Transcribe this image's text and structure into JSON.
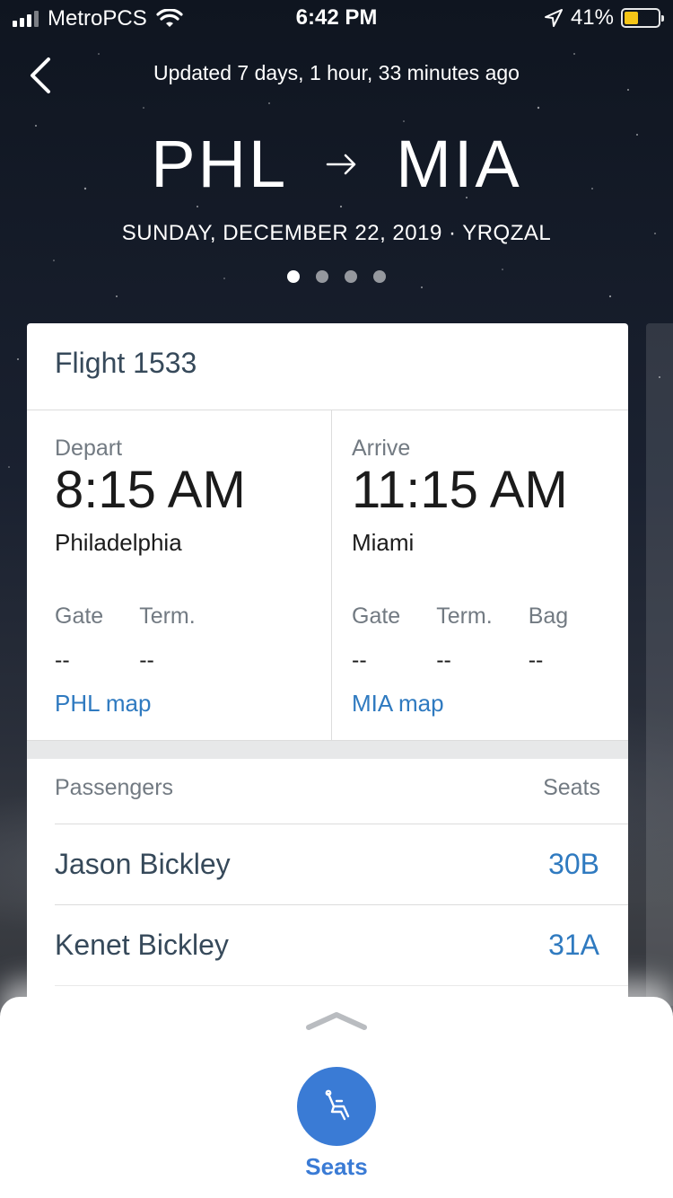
{
  "status_bar": {
    "carrier": "MetroPCS",
    "time": "6:42 PM",
    "battery": "41%"
  },
  "header": {
    "updated": "Updated 7 days, 1 hour, 33 minutes ago",
    "origin": "PHL",
    "destination": "MIA",
    "date_line": "SUNDAY, DECEMBER 22, 2019 · YRQZAL",
    "pages": 4,
    "active_page": 1
  },
  "card": {
    "flight": "Flight 1533",
    "depart": {
      "label": "Depart",
      "time": "8:15 AM",
      "city": "Philadelphia",
      "gate_label": "Gate",
      "gate": "--",
      "term_label": "Term.",
      "term": "--",
      "map": "PHL map"
    },
    "arrive": {
      "label": "Arrive",
      "time": "11:15 AM",
      "city": "Miami",
      "gate_label": "Gate",
      "gate": "--",
      "term_label": "Term.",
      "term": "--",
      "bag_label": "Bag",
      "bag": "--",
      "map": "MIA map"
    },
    "passengers_label": "Passengers",
    "seats_label": "Seats",
    "passengers": [
      {
        "name": "Jason Bickley",
        "seat": "30B"
      },
      {
        "name": "Kenet Bickley",
        "seat": "31A"
      }
    ]
  },
  "bottom": {
    "button_label": "Seats"
  },
  "colors": {
    "accent": "#2f7ac0",
    "button": "#3a7bd5",
    "battery": "#f5c518"
  },
  "icons": [
    "back-arrow-icon",
    "right-arrow-icon",
    "wifi-icon",
    "location-icon",
    "chevron-up-icon",
    "seat-icon"
  ]
}
